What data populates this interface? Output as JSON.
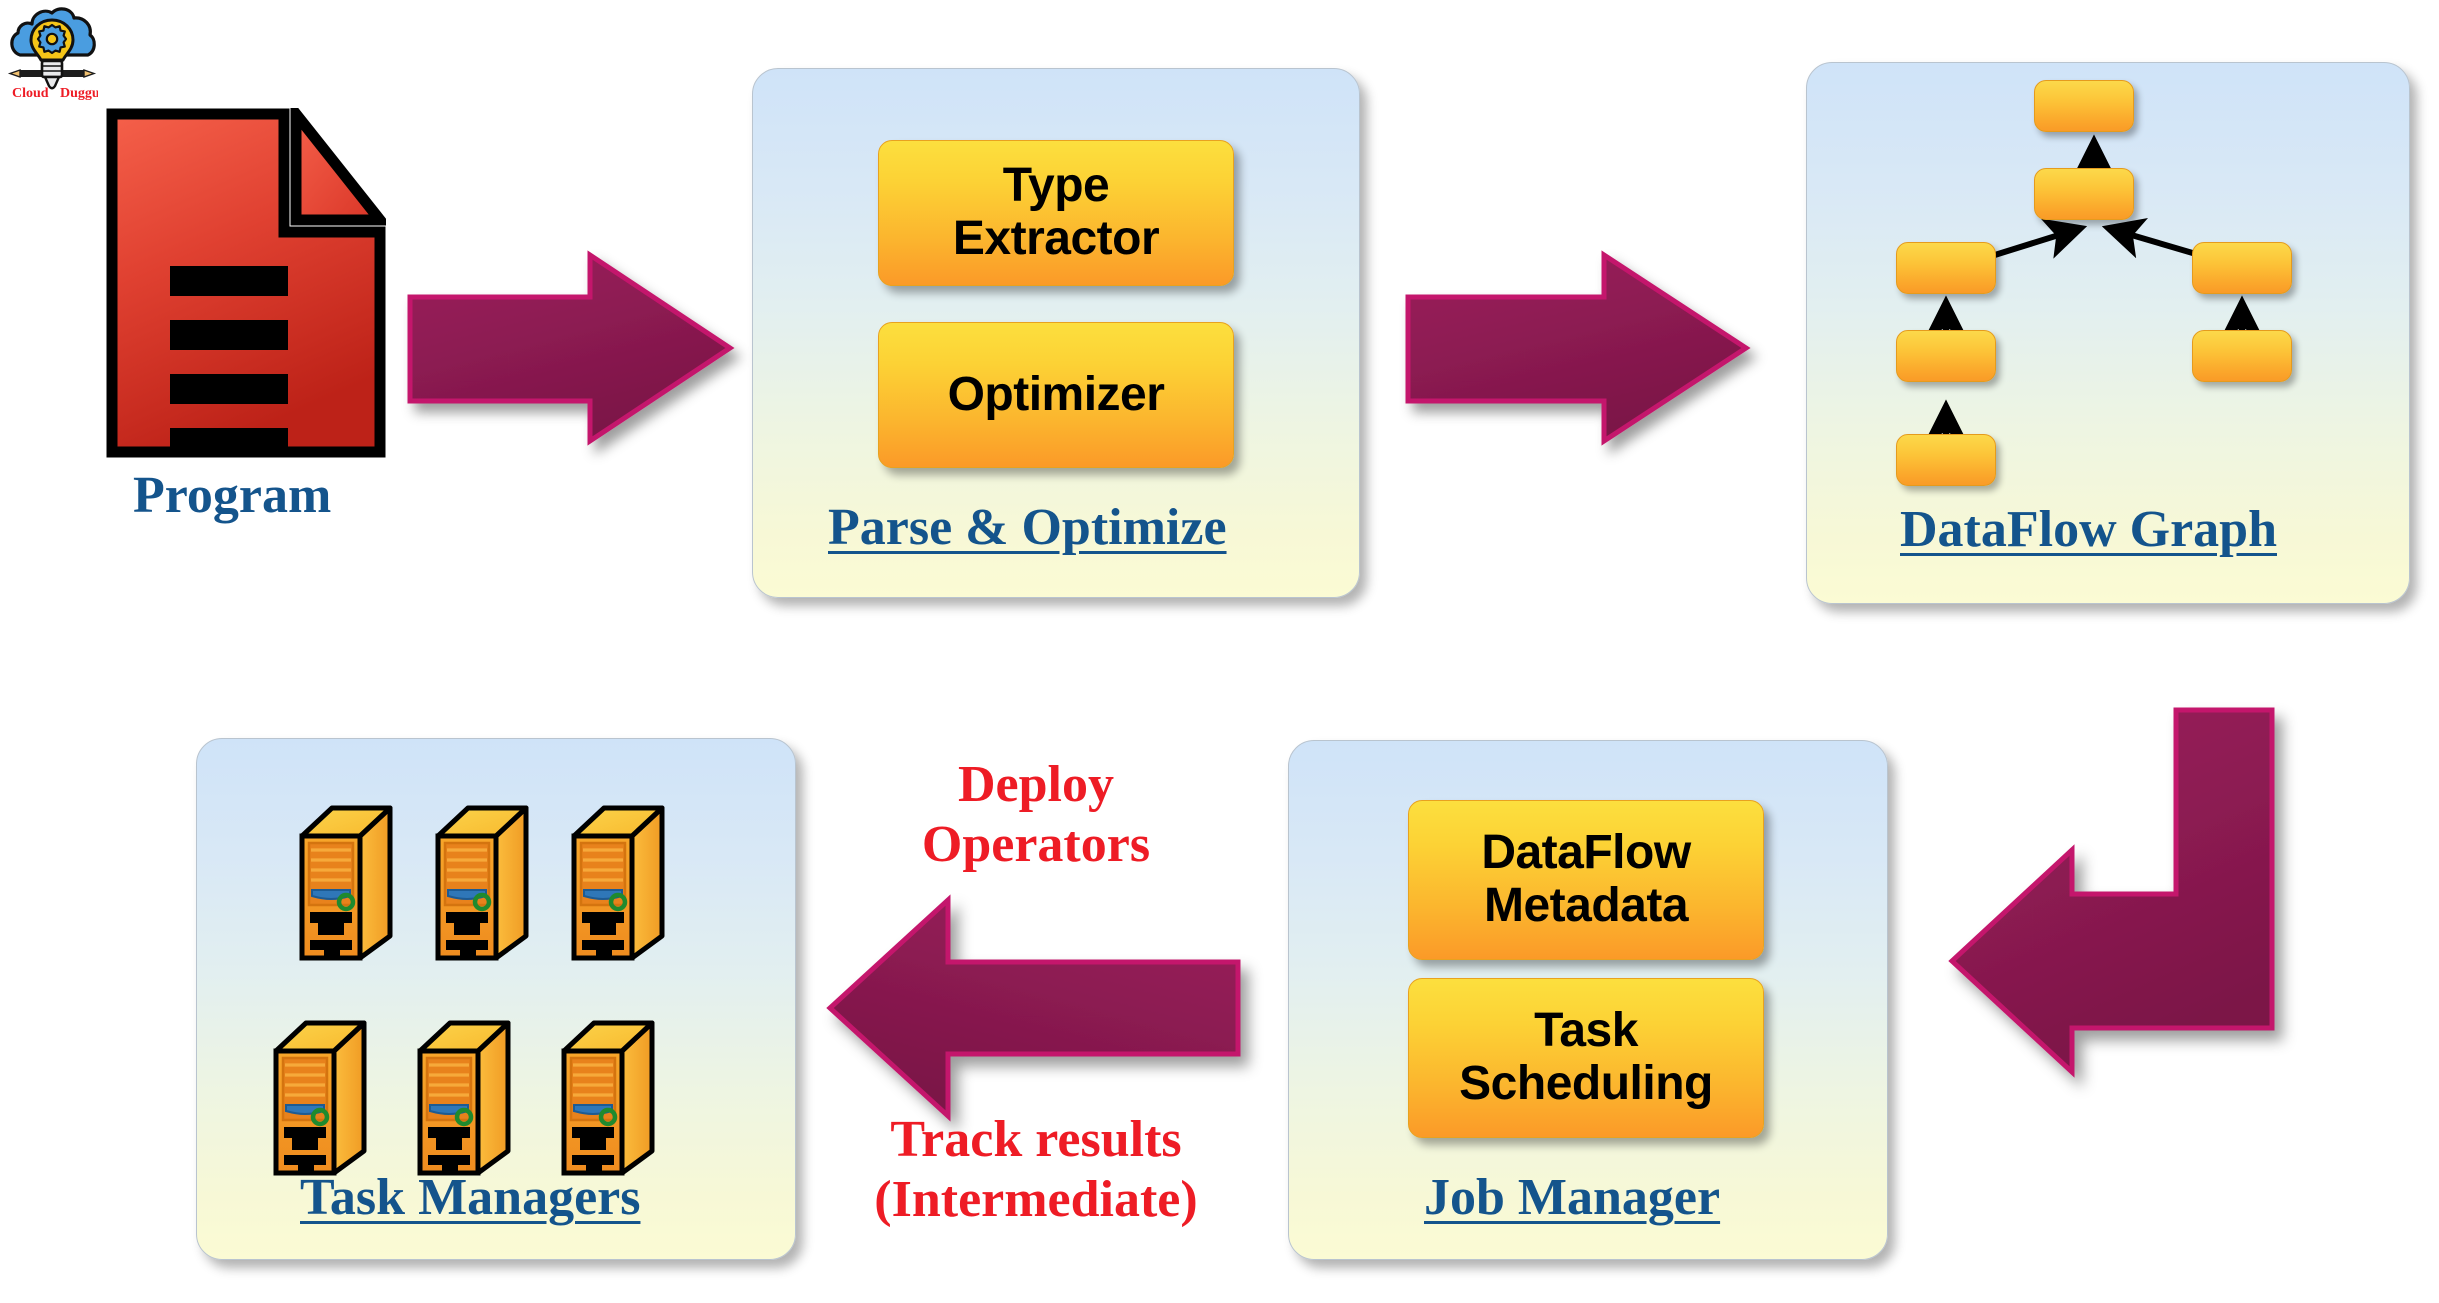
{
  "logo": {
    "brand_primary": "Cloud",
    "brand_secondary": "Duggu",
    "icon": "cloud-lightbulb-gear-logo",
    "colors": {
      "cloud": "#4a9de0",
      "bulb": "#f5c518",
      "gear": "#4a9de0",
      "text": "#ee1c25"
    }
  },
  "colors": {
    "arrow_fill": "#8e1b53",
    "arrow_border": "#c4186c",
    "panel_top": "#cfe3f8",
    "panel_bottom": "#fbfbd4",
    "box_top": "#fcdf3e",
    "box_bottom": "#fb9a28",
    "caption": "#14548c",
    "red_label": "#ee1c25",
    "doc_top": "#f2513d",
    "doc_bottom": "#c1271c",
    "server_body": "#f5a623",
    "server_panel": "#ef8a22",
    "server_led": "#1f8a2e",
    "server_handle": "#2f77b8"
  },
  "stages": {
    "program": {
      "caption": "Program",
      "icon": "document-icon",
      "line_count": 4
    },
    "parse_optimize": {
      "caption": "Parse & Optimize",
      "boxes": [
        {
          "label": "Type\nExtractor",
          "line1": "Type",
          "line2": "Extractor"
        },
        {
          "label": "Optimizer",
          "line1": "Optimizer",
          "line2": ""
        }
      ]
    },
    "dataflow_graph": {
      "caption": "DataFlow Graph",
      "node_count": 7,
      "edge_count": 6,
      "nodes": [
        {
          "id": "n1",
          "role": "sink-top"
        },
        {
          "id": "n2",
          "role": "join"
        },
        {
          "id": "n3",
          "role": "left-branch-upper"
        },
        {
          "id": "n4",
          "role": "left-branch-middle"
        },
        {
          "id": "n5",
          "role": "left-branch-source"
        },
        {
          "id": "n6",
          "role": "right-branch-upper"
        },
        {
          "id": "n7",
          "role": "right-branch-source"
        }
      ],
      "edges": [
        {
          "from": "n2",
          "to": "n1"
        },
        {
          "from": "n3",
          "to": "n2"
        },
        {
          "from": "n6",
          "to": "n2"
        },
        {
          "from": "n4",
          "to": "n3"
        },
        {
          "from": "n5",
          "to": "n4"
        },
        {
          "from": "n7",
          "to": "n6"
        }
      ]
    },
    "job_manager": {
      "caption": "Job Manager",
      "boxes": [
        {
          "line1": "DataFlow",
          "line2": "Metadata"
        },
        {
          "line1": "Task",
          "line2": "Scheduling"
        }
      ]
    },
    "task_managers": {
      "caption": "Task Managers",
      "server_count": 6,
      "icon": "server-tower-icon"
    }
  },
  "flow_labels": {
    "deploy": {
      "line1": "Deploy",
      "line2": "Operators"
    },
    "track": {
      "line1": "Track results",
      "line2": "(Intermediate)"
    }
  },
  "arrows": {
    "program_to_parse": "arrow-right-icon",
    "parse_to_graph": "arrow-right-icon",
    "graph_to_jobmanager": "arrow-elbow-down-left-icon",
    "jobmanager_to_taskmanagers": "arrow-left-icon"
  }
}
